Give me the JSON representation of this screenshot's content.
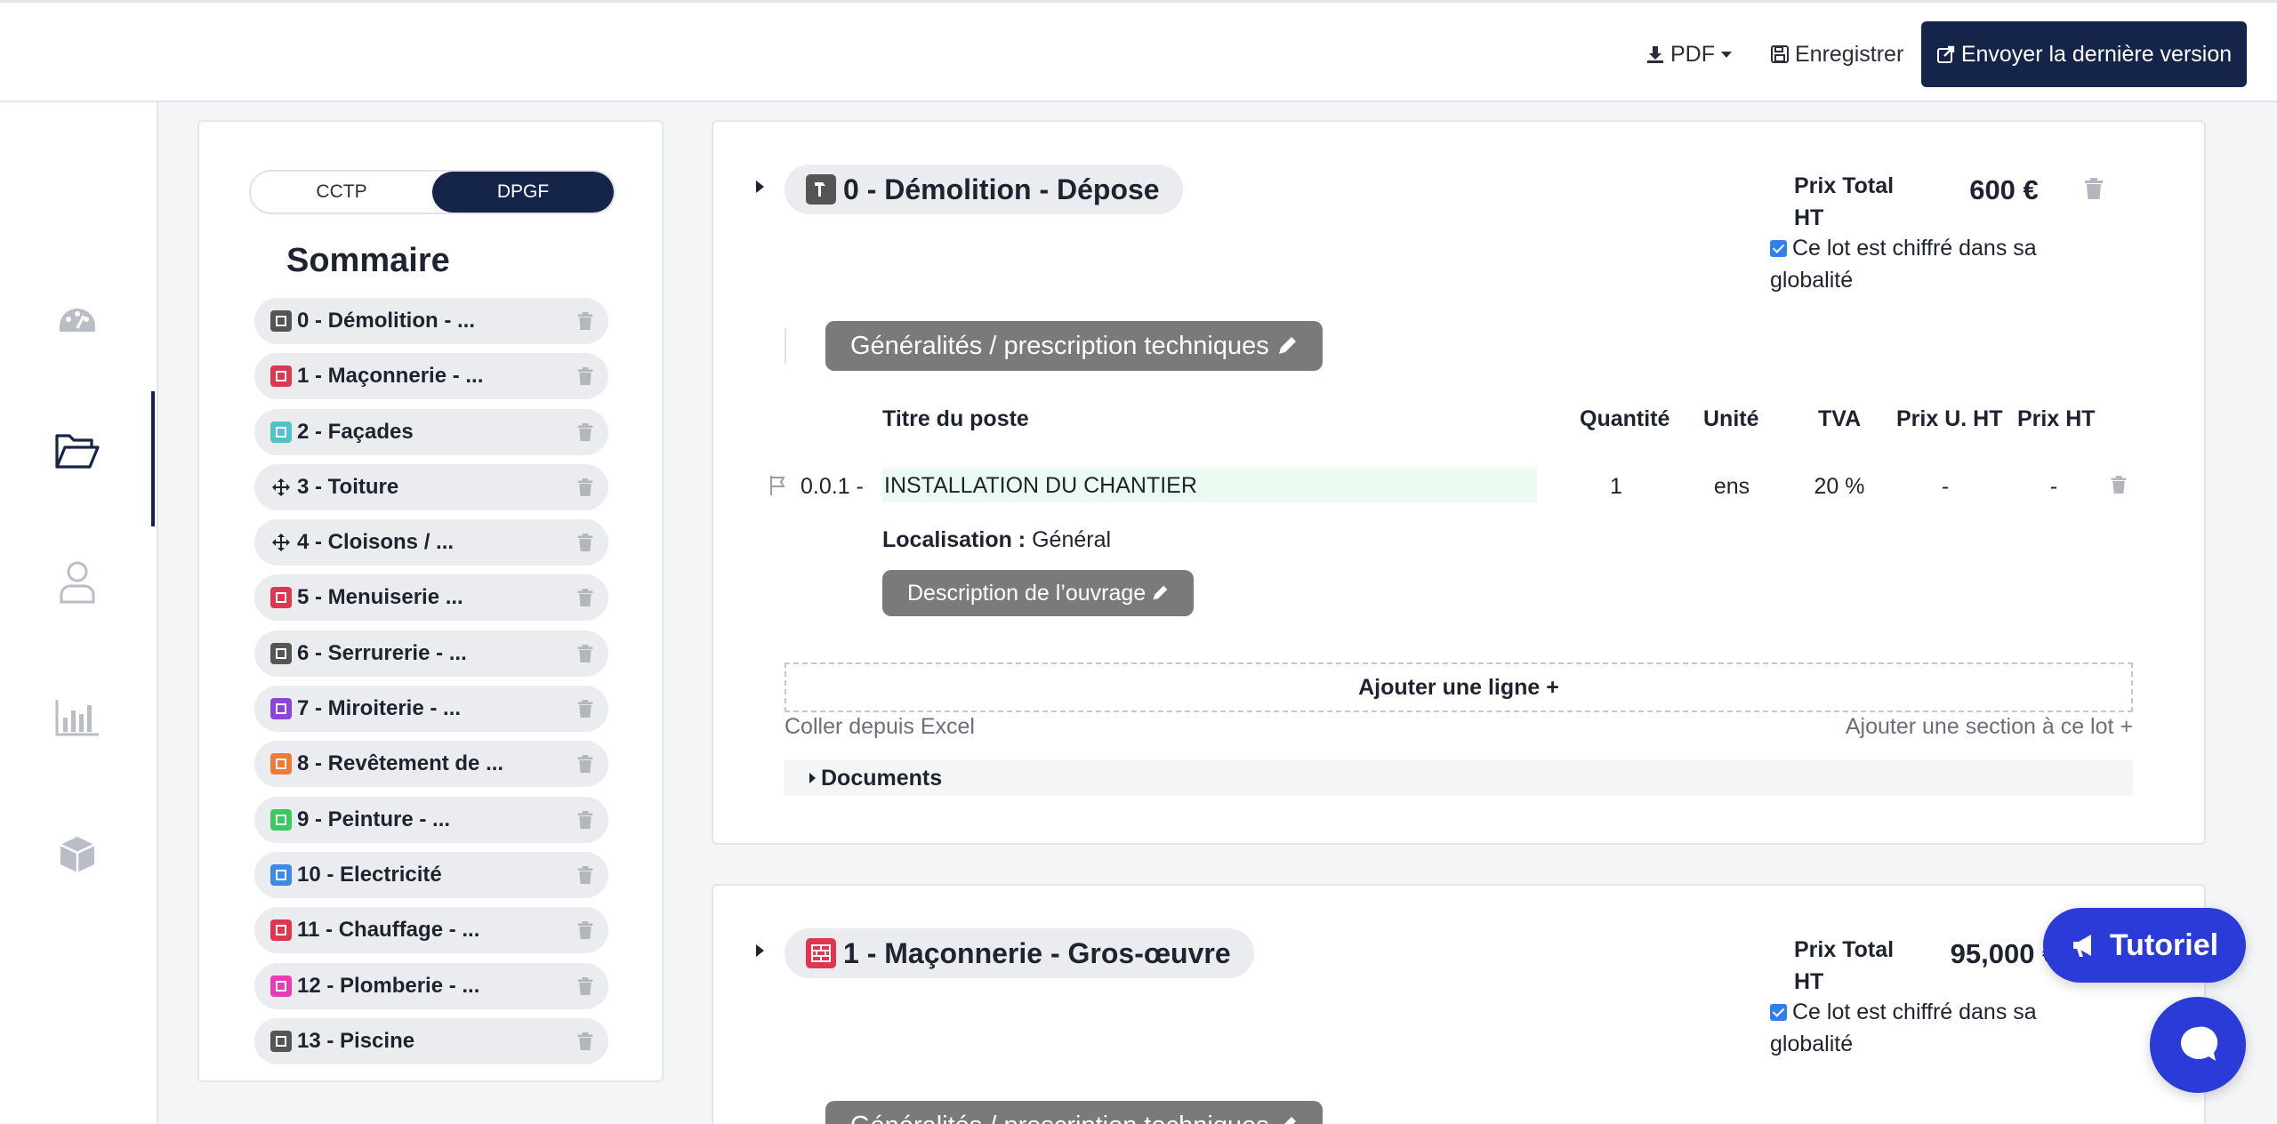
{
  "topbar": {
    "pdf_label": "PDF",
    "save_label": "Enregistrer",
    "send_label": "Envoyer la dernière version"
  },
  "rail": {
    "items": [
      "dashboard-icon",
      "folder-icon",
      "user-icon",
      "chart-icon",
      "box-icon"
    ],
    "active": "folder-icon"
  },
  "sommaire": {
    "tabs": [
      "CCTP",
      "DPGF"
    ],
    "active_tab": "DPGF",
    "title": "Sommaire",
    "items": [
      {
        "label": "0 - Démolition - ...",
        "color": "#555555"
      },
      {
        "label": "1 - Maçonnerie - ...",
        "color": "#e0364f"
      },
      {
        "label": "2 - Façades",
        "color": "#4fc3c8"
      },
      {
        "label": "3 - Toiture",
        "color": "#1f2330"
      },
      {
        "label": "4 - Cloisons / ...",
        "color": "#1f2330"
      },
      {
        "label": "5 - Menuiserie ...",
        "color": "#e0364f"
      },
      {
        "label": "6 - Serrurerie - ...",
        "color": "#555555"
      },
      {
        "label": "7 - Miroiterie - ...",
        "color": "#8e44d8"
      },
      {
        "label": "8 - Revêtement de ...",
        "color": "#f07a3a"
      },
      {
        "label": "9 - Peinture - ...",
        "color": "#3cc85a"
      },
      {
        "label": "10 - Electricité",
        "color": "#3a8ae6"
      },
      {
        "label": "11 - Chauffage - ...",
        "color": "#e0364f"
      },
      {
        "label": "12 - Plomberie - ...",
        "color": "#e83cb5"
      },
      {
        "label": "13 - Piscine",
        "color": "#555555"
      }
    ]
  },
  "lots": [
    {
      "title": "0 - Démolition - Dépose",
      "icon_color": "#555555",
      "prix_label": "Prix Total HT",
      "prix_value": "600 €",
      "global_label": "Ce lot est chiffré dans sa globalité",
      "gen_label": "Généralités / prescription techniques",
      "columns": [
        "Titre du poste",
        "Quantité",
        "Unité",
        "TVA",
        "Prix U. HT",
        "Prix HT"
      ],
      "row": {
        "num": "0.0.1 -",
        "title": "INSTALLATION DU CHANTIER",
        "qty": "1",
        "unit": "ens",
        "tva": "20 %",
        "pu": "-",
        "pht": "-"
      },
      "loc_label": "Localisation :",
      "loc_value": "Général",
      "desc_label": "Description de l’ouvrage",
      "add_line": "Ajouter une ligne +",
      "paste": "Coller depuis Excel",
      "add_section": "Ajouter une section à ce lot +",
      "documents": "Documents"
    },
    {
      "title": "1 - Maçonnerie - Gros-œuvre",
      "icon_color": "#e0364f",
      "prix_label": "Prix Total HT",
      "prix_value": "95,000 €",
      "global_label": "Ce lot est chiffré dans sa globalité",
      "gen_label": "Généralités / prescription techniques"
    }
  ],
  "floating": {
    "tutoriel": "Tutoriel"
  }
}
